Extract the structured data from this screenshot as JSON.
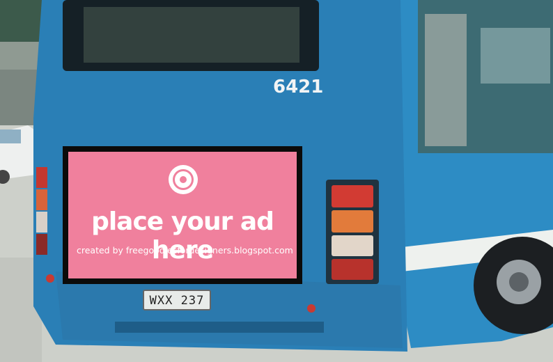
{
  "scene": {
    "description_colors": {
      "bus_body": "#2f7fb1",
      "ad_background": "#f07f9c",
      "sky": "#dfe6e0",
      "road": "#cfd2cc"
    }
  },
  "bus": {
    "fleet_number": "6421",
    "license_plate": "WXX 237"
  },
  "ad": {
    "icon": "donut-icon",
    "headline": "place your ad here",
    "credit": "created by freegoodiesfordesigners.blogspot.com"
  }
}
